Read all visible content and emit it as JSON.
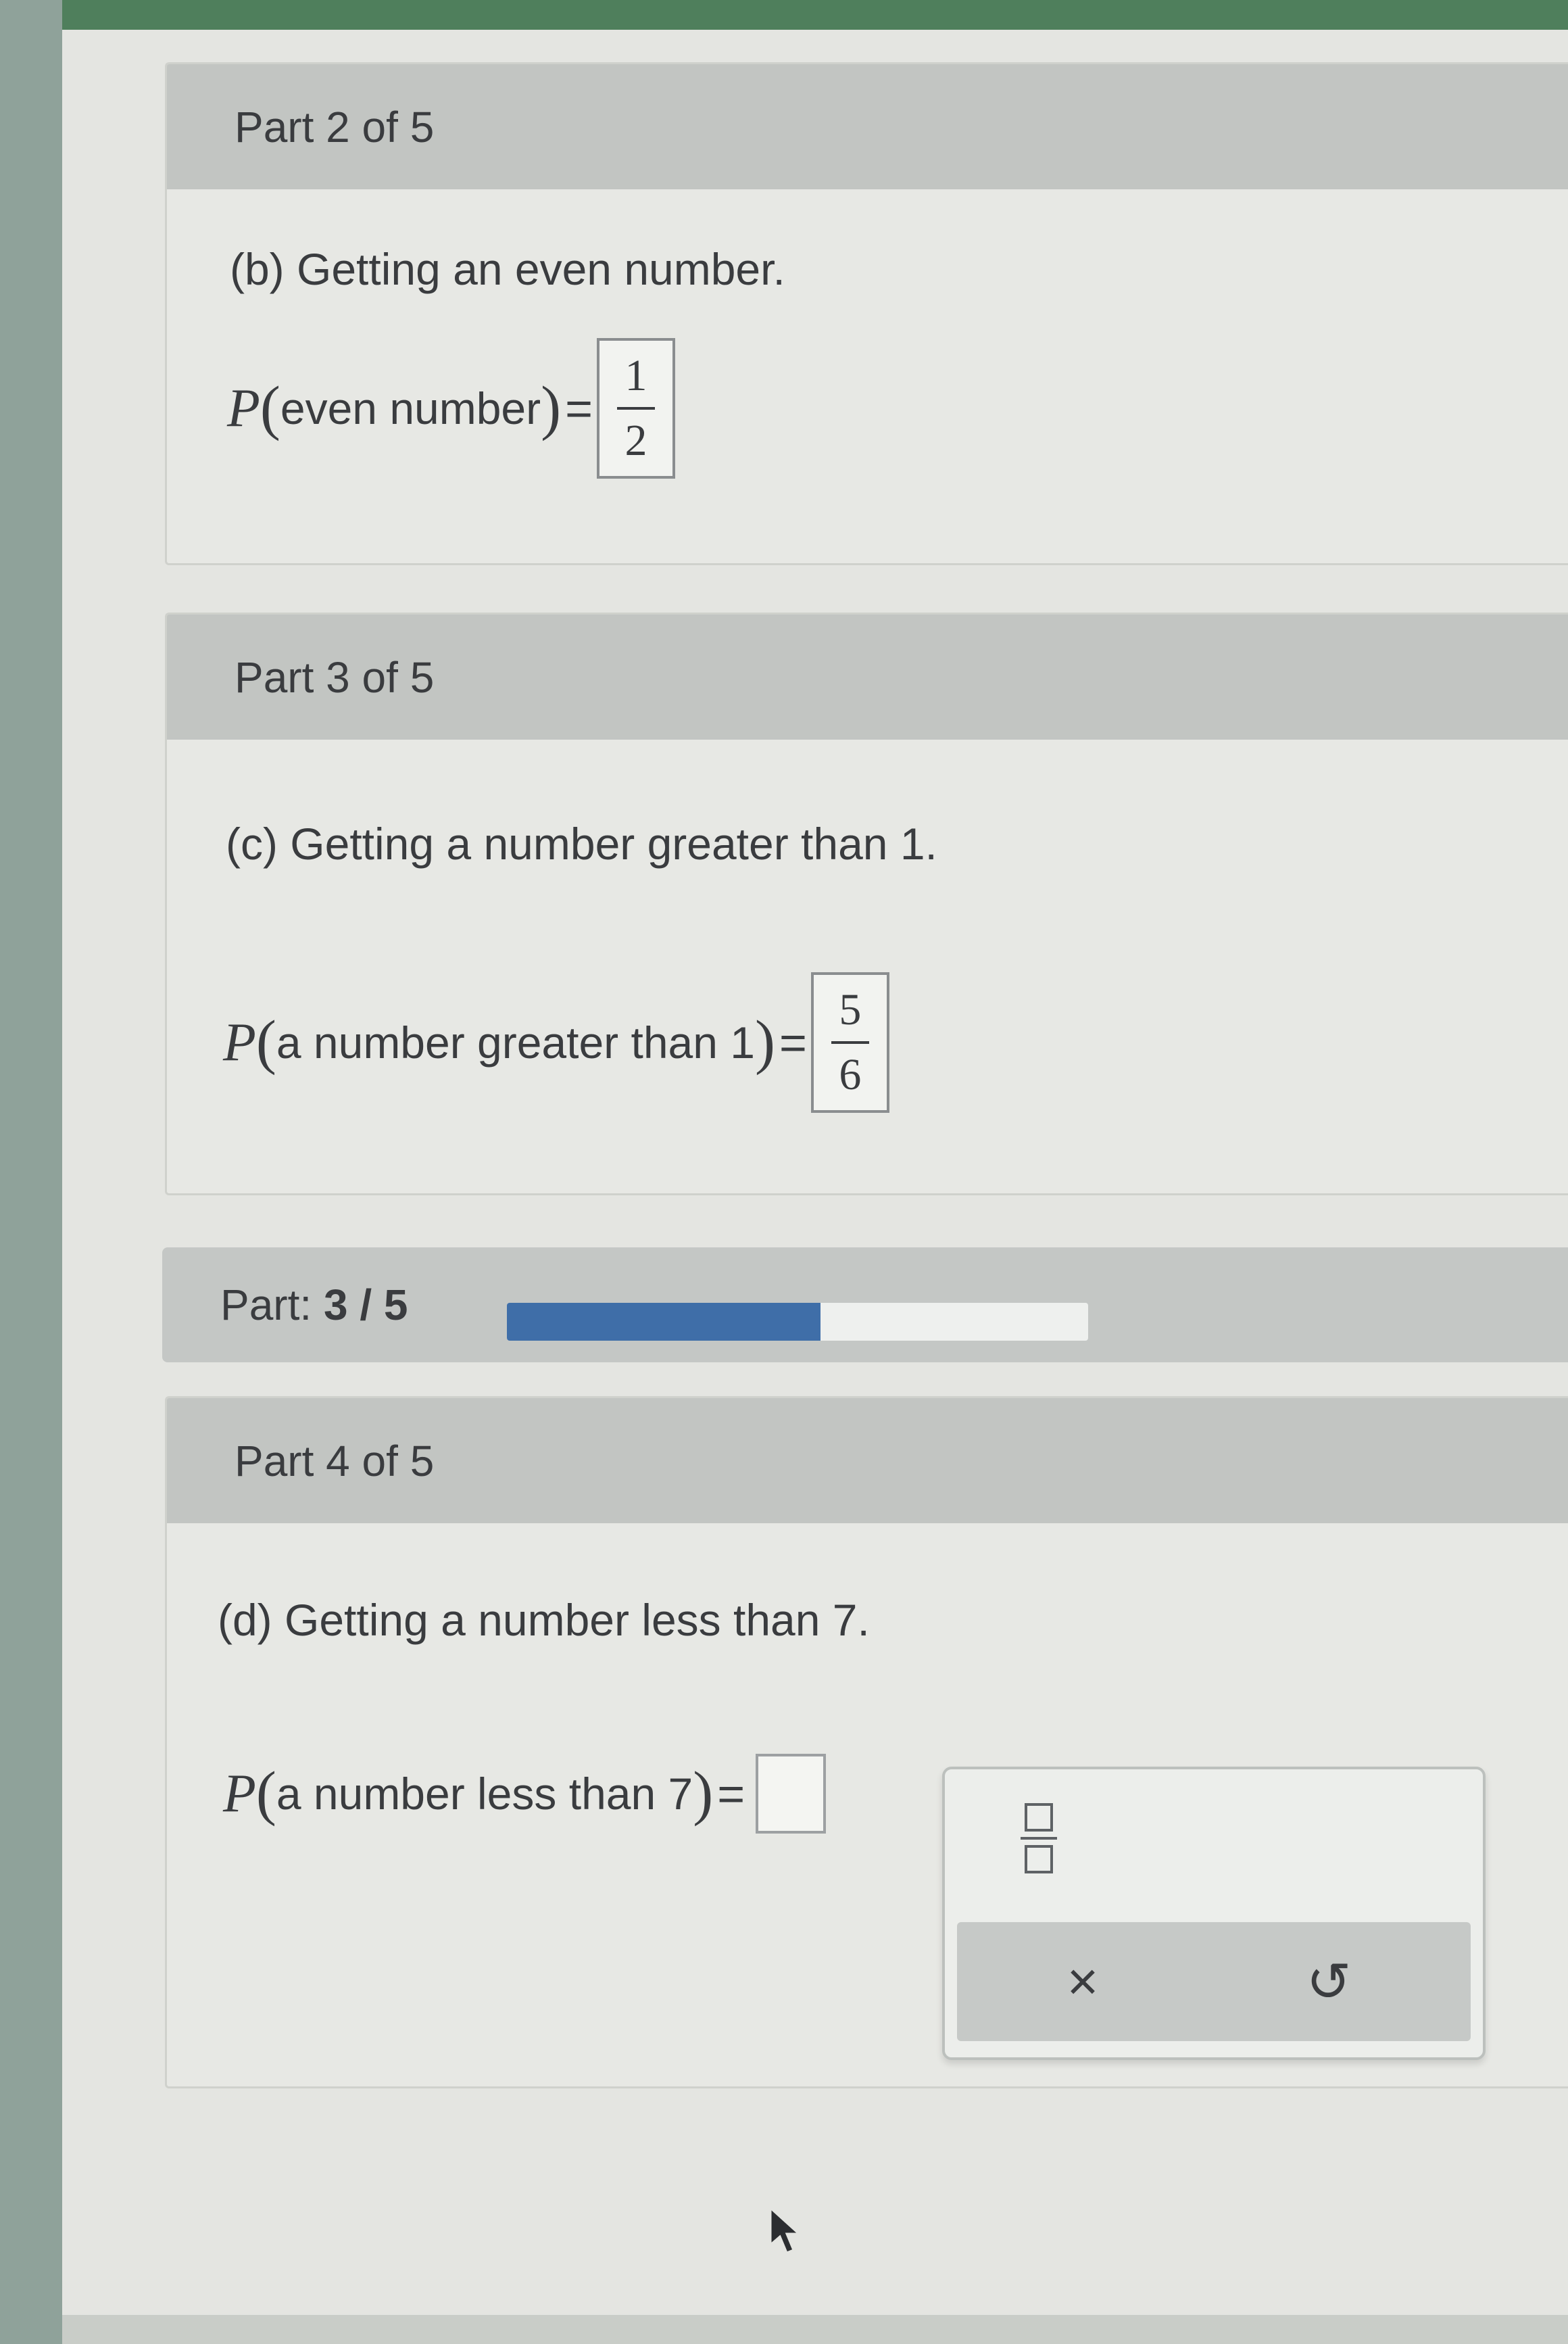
{
  "part2": {
    "header": "Part 2 of 5",
    "question": "(b) Getting an even number.",
    "prob_letter": "P",
    "prob_event": "even number",
    "equals": "=",
    "answer_num": "1",
    "answer_den": "2"
  },
  "part3": {
    "header": "Part 3 of 5",
    "question": "(c) Getting a number greater than 1.",
    "prob_letter": "P",
    "prob_event": "a number greater than 1",
    "equals": "=",
    "answer_num": "5",
    "answer_den": "6"
  },
  "progress": {
    "label_prefix": "Part:",
    "label_value": "3 / 5",
    "completed_parts": 3,
    "total_parts": 5
  },
  "part4": {
    "header": "Part 4 of 5",
    "question": "(d) Getting a number less than 7.",
    "prob_letter": "P",
    "prob_event": "a number less than 7",
    "equals": "="
  },
  "palette": {
    "fraction_tool_icon": "fraction-icon",
    "clear_symbol": "×",
    "undo_symbol": "↺"
  },
  "colors": {
    "progress_fill": "#3f6ea8",
    "header_bg": "#c2c5c2"
  }
}
